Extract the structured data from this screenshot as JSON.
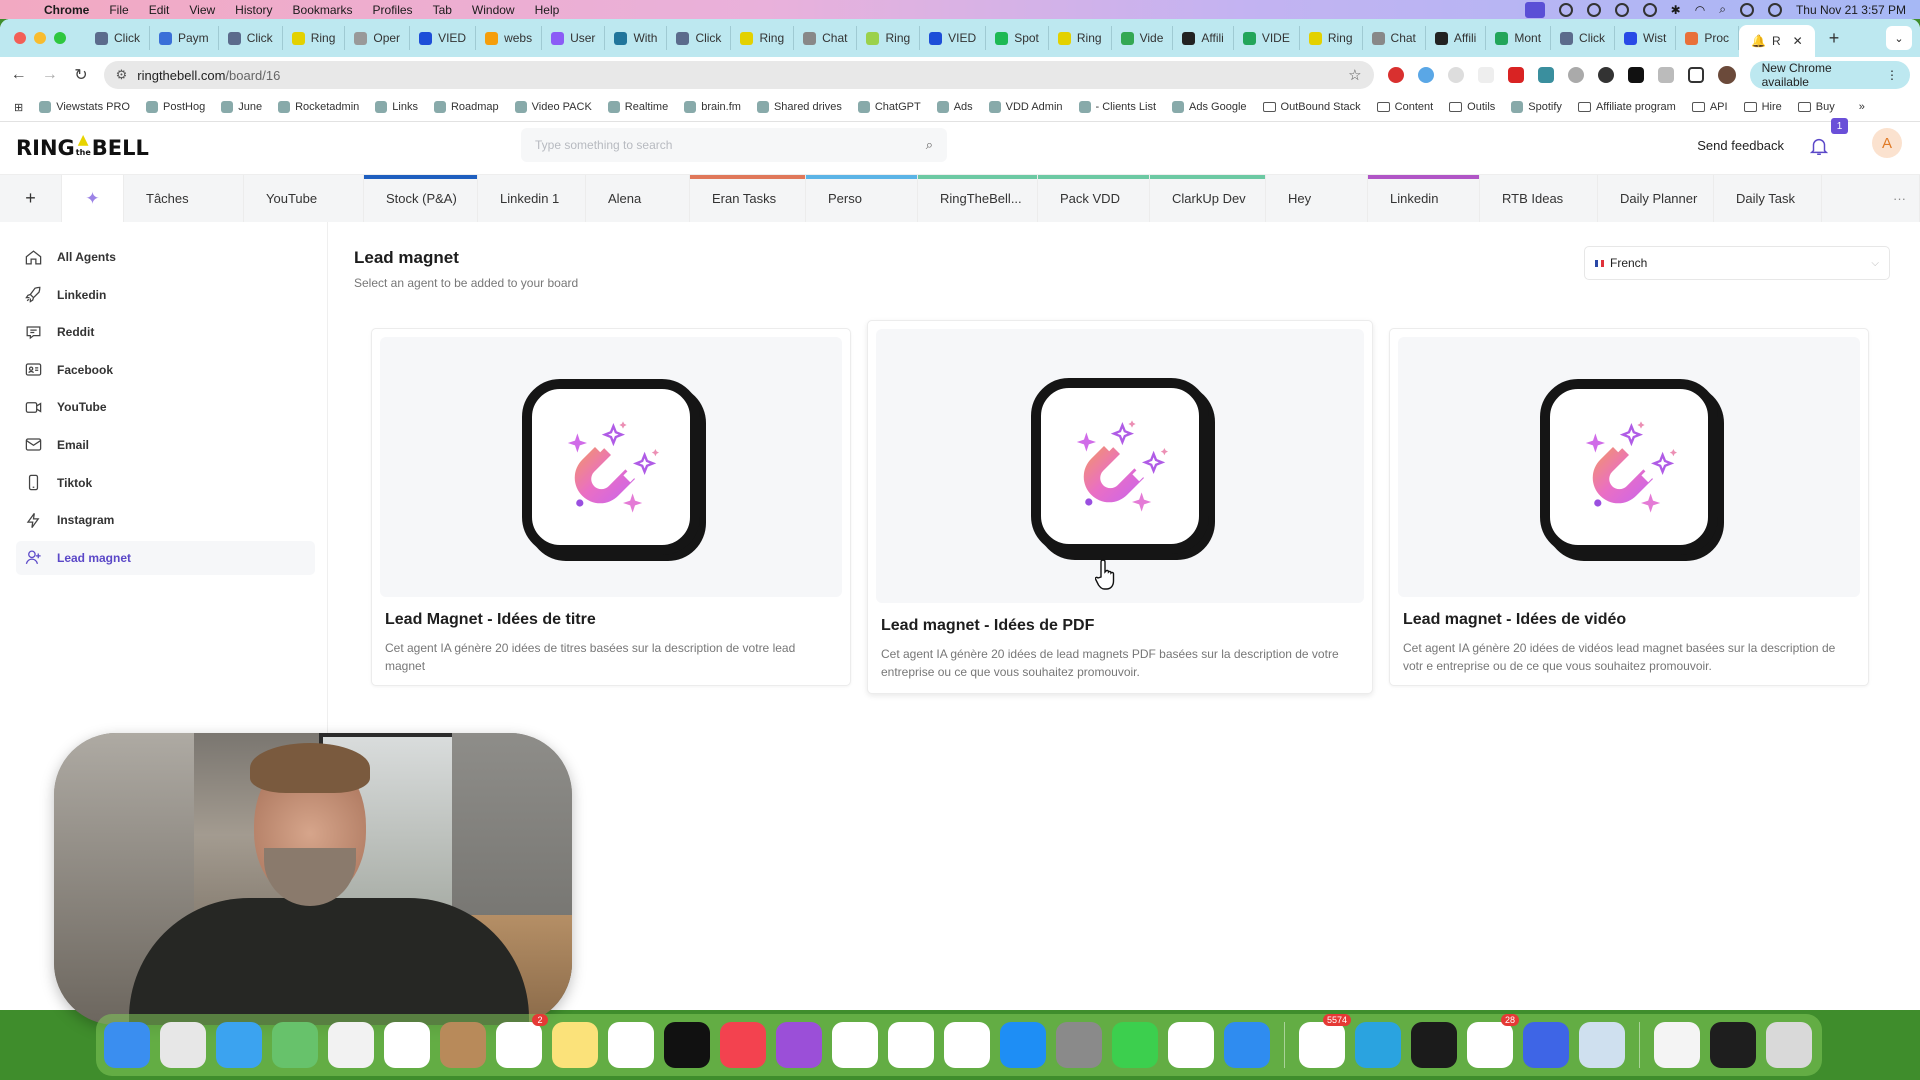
{
  "menubar": {
    "app_name": "Chrome",
    "menus": [
      "File",
      "Edit",
      "View",
      "History",
      "Bookmarks",
      "Profiles",
      "Tab",
      "Window",
      "Help"
    ],
    "clock": "Thu Nov 21  3:57 PM"
  },
  "browser": {
    "tabs": [
      {
        "label": "Click",
        "color": "#5b6b8c"
      },
      {
        "label": "Paym",
        "color": "#3a6fd8"
      },
      {
        "label": "Click",
        "color": "#5b6b8c"
      },
      {
        "label": "Ring",
        "color": "#e3d100"
      },
      {
        "label": "Oper",
        "color": "#999999"
      },
      {
        "label": "VIED",
        "color": "#1d4ed8"
      },
      {
        "label": "webs",
        "color": "#f59e0b"
      },
      {
        "label": "User",
        "color": "#8b5cf6"
      },
      {
        "label": "With",
        "color": "#21759b"
      },
      {
        "label": "Click",
        "color": "#5b6b8c"
      },
      {
        "label": "Ring",
        "color": "#e3d100"
      },
      {
        "label": "Chat",
        "color": "#888888"
      },
      {
        "label": "Ring",
        "color": "#9bd14b"
      },
      {
        "label": "VIED",
        "color": "#1d4ed8"
      },
      {
        "label": "Spot",
        "color": "#1db954"
      },
      {
        "label": "Ring",
        "color": "#e3d100"
      },
      {
        "label": "Vide",
        "color": "#34a853"
      },
      {
        "label": "Affili",
        "color": "#222222"
      },
      {
        "label": "VIDE",
        "color": "#23a55a"
      },
      {
        "label": "Ring",
        "color": "#e3d100"
      },
      {
        "label": "Chat",
        "color": "#888888"
      },
      {
        "label": "Affili",
        "color": "#222222"
      },
      {
        "label": "Mont",
        "color": "#23a55a"
      },
      {
        "label": "Click",
        "color": "#5b6b8c"
      },
      {
        "label": "Wist",
        "color": "#2949e6"
      },
      {
        "label": "Proc",
        "color": "#e8703a"
      }
    ],
    "active_tab": {
      "label": "R",
      "color": "#e3d100"
    },
    "url_host": "ringthebell.com",
    "url_path": "/board/16",
    "update_button": "New Chrome available",
    "bookmarks": [
      {
        "label": "Viewstats PRO",
        "icon": "v-icon"
      },
      {
        "label": "PostHog",
        "icon": "posthog-icon"
      },
      {
        "label": "June",
        "icon": "june-icon"
      },
      {
        "label": "Rocketadmin",
        "icon": "rocket-icon"
      },
      {
        "label": "Links",
        "icon": "sheets-icon"
      },
      {
        "label": "Roadmap",
        "icon": "roadmap-icon"
      },
      {
        "label": "Video PACK",
        "icon": "drive-icon"
      },
      {
        "label": "Realtime",
        "icon": "google-icon"
      },
      {
        "label": "brain.fm",
        "icon": "brain-icon"
      },
      {
        "label": "Shared drives",
        "icon": "drive-icon"
      },
      {
        "label": "ChatGPT",
        "icon": "openai-icon"
      },
      {
        "label": "Ads",
        "icon": "meta-icon"
      },
      {
        "label": "VDD Admin",
        "icon": "wordpress-icon"
      },
      {
        "label": "- Clients List",
        "icon": "globe-icon"
      },
      {
        "label": "Ads Google",
        "icon": "google-ads-icon"
      },
      {
        "label": "OutBound Stack",
        "icon": "folder-icon"
      },
      {
        "label": "Content",
        "icon": "folder-icon"
      },
      {
        "label": "Outils",
        "icon": "folder-icon"
      },
      {
        "label": "Spotify",
        "icon": "spotify-icon"
      },
      {
        "label": "Affiliate program",
        "icon": "folder-icon"
      },
      {
        "label": "API",
        "icon": "folder-icon"
      },
      {
        "label": "Hire",
        "icon": "folder-icon"
      },
      {
        "label": "Buy",
        "icon": "folder-icon"
      }
    ],
    "bookmarks_overflow": "»"
  },
  "app": {
    "logo_left": "RING",
    "logo_mid": "the",
    "logo_right": "BELL",
    "search_placeholder": "Type something to search",
    "feedback": "Send feedback",
    "notification_count": "1",
    "avatar_initial": "A",
    "board_tabs": [
      {
        "label": "Tâches",
        "color": ""
      },
      {
        "label": "YouTube",
        "color": ""
      },
      {
        "label": "Stock (P&A)",
        "color": "#1f5fbf"
      },
      {
        "label": "Linkedin 1",
        "color": ""
      },
      {
        "label": "Alena",
        "color": ""
      },
      {
        "label": "Eran Tasks",
        "color": "#e0785a"
      },
      {
        "label": "Perso",
        "color": "#5bb4e6"
      },
      {
        "label": "RingTheBell...",
        "color": "#6cc9a3"
      },
      {
        "label": "Pack VDD",
        "color": "#6cc9a3"
      },
      {
        "label": "ClarkUp Dev",
        "color": "#6cc9a3"
      },
      {
        "label": "Hey",
        "color": ""
      },
      {
        "label": "Linkedin",
        "color": "#b055c6"
      },
      {
        "label": "RTB Ideas",
        "color": ""
      },
      {
        "label": "Daily Planner",
        "color": ""
      },
      {
        "label": "Daily Task",
        "color": ""
      }
    ],
    "add_tab": "+",
    "more_tabs": "···",
    "sidebar": [
      {
        "label": "All Agents",
        "icon": "home-icon"
      },
      {
        "label": "Linkedin",
        "icon": "rocket-icon"
      },
      {
        "label": "Reddit",
        "icon": "message-icon"
      },
      {
        "label": "Facebook",
        "icon": "id-card-icon"
      },
      {
        "label": "YouTube",
        "icon": "video-icon"
      },
      {
        "label": "Email",
        "icon": "mail-icon"
      },
      {
        "label": "Tiktok",
        "icon": "phone-icon"
      },
      {
        "label": "Instagram",
        "icon": "bolt-icon"
      },
      {
        "label": "Lead magnet",
        "icon": "user-plus-icon",
        "active": true
      }
    ],
    "page_title": "Lead magnet",
    "page_subtitle": "Select an agent to be added to your board",
    "language": "French",
    "cards": [
      {
        "title": "Lead Magnet - Idées de titre",
        "desc": "Cet agent IA génère 20 idées de titres basées sur la description de votre lead magnet"
      },
      {
        "title": "Lead magnet - Idées de PDF",
        "desc": "Cet agent IA génère 20 idées de lead magnets PDF basées sur la description de votre entreprise ou ce que vous souhaitez promouvoir."
      },
      {
        "title": "Lead magnet - Idées de vidéo",
        "desc": "Cet agent IA génère 20 idées de vidéos lead magnet basées sur la description de votr e entreprise ou de ce que vous souhaitez promouvoir."
      }
    ]
  },
  "dock": {
    "apps": [
      {
        "name": "Finder",
        "color": "#3a8ef0"
      },
      {
        "name": "Launchpad",
        "color": "#e7e7e7"
      },
      {
        "name": "Mail",
        "color": "#3ba3f0"
      },
      {
        "name": "Maps",
        "color": "#67c26b"
      },
      {
        "name": "Photos",
        "color": "#f2f2f2"
      },
      {
        "name": "Calendar",
        "color": "#ffffff"
      },
      {
        "name": "Contacts",
        "color": "#b88a5a"
      },
      {
        "name": "Reminders",
        "color": "#ffffff",
        "badge": "2"
      },
      {
        "name": "Notes",
        "color": "#fbe27a"
      },
      {
        "name": "Freeform",
        "color": "#ffffff"
      },
      {
        "name": "Apple TV",
        "color": "#111111"
      },
      {
        "name": "Music",
        "color": "#f3424f"
      },
      {
        "name": "Podcasts",
        "color": "#9b4fd8"
      },
      {
        "name": "Keynote",
        "color": "#ffffff"
      },
      {
        "name": "Numbers",
        "color": "#ffffff"
      },
      {
        "name": "Pages",
        "color": "#ffffff"
      },
      {
        "name": "App Store",
        "color": "#1e8ef5"
      },
      {
        "name": "System Settings",
        "color": "#8a8a8a"
      },
      {
        "name": "FaceTime",
        "color": "#3ccf4e"
      },
      {
        "name": "Chrome",
        "color": "#ffffff"
      },
      {
        "name": "Safari",
        "color": "#2f8cf0"
      },
      {
        "name": "Fantastical",
        "color": "#ffffff",
        "badge": "5574"
      },
      {
        "name": "Telegram",
        "color": "#2aa3e0"
      },
      {
        "name": "Screen Studio",
        "color": "#1b1b1b"
      },
      {
        "name": "Slack",
        "color": "#ffffff",
        "badge": "28"
      },
      {
        "name": "NordVPN",
        "color": "#3e65e6"
      },
      {
        "name": "Preview",
        "color": "#cfe0ef"
      }
    ],
    "files": [
      {
        "name": "XLSX file",
        "color": "#f4f4f4"
      },
      {
        "name": "Recent window",
        "color": "#1e1e1e"
      },
      {
        "name": "Trash",
        "color": "#d9d9d9"
      }
    ]
  }
}
